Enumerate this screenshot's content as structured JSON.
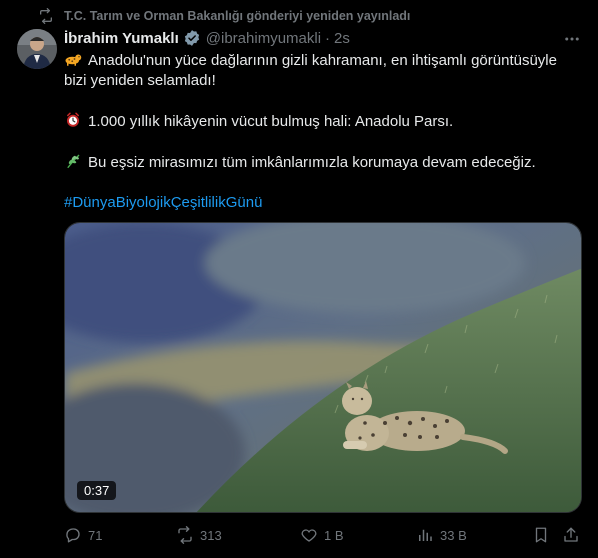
{
  "repost": {
    "text": "T.C. Tarım ve Orman Bakanlığı gönderiyi yeniden yayınladı"
  },
  "author": {
    "name": "İbrahim Yumaklı",
    "handle": "@ibrahimyumakli",
    "separator": "·",
    "time": "2s"
  },
  "tweet": {
    "line1": "Anadolu'nun yüce dağlarının gizli kahramanı, en ihtişamlı görüntüsüyle",
    "line2": "bizi yeniden selamladı!",
    "line3": "1.000 yıllık hikâyenin vücut bulmuş hali: Anadolu Parsı.",
    "line4": "Bu eşsiz mirasımızı tüm imkânlarımızla korumaya devam edeceğiz.",
    "hashtag": "#DünyaBiyolojikÇeşitlilikGünü"
  },
  "media": {
    "duration": "0:37"
  },
  "actions": {
    "replies": "71",
    "reposts": "313",
    "likes": "1 B",
    "views": "33 B"
  },
  "colors": {
    "accent": "#1d9bf0",
    "muted": "#71767b",
    "text": "#e7e9ea",
    "background": "#000000"
  },
  "icons": [
    "repost-icon",
    "verified-badge-icon",
    "more-icon",
    "leopard-emoji-icon",
    "clock-emoji-icon",
    "herb-emoji-icon",
    "reply-icon",
    "like-icon",
    "views-icon",
    "bookmark-icon",
    "share-icon"
  ]
}
